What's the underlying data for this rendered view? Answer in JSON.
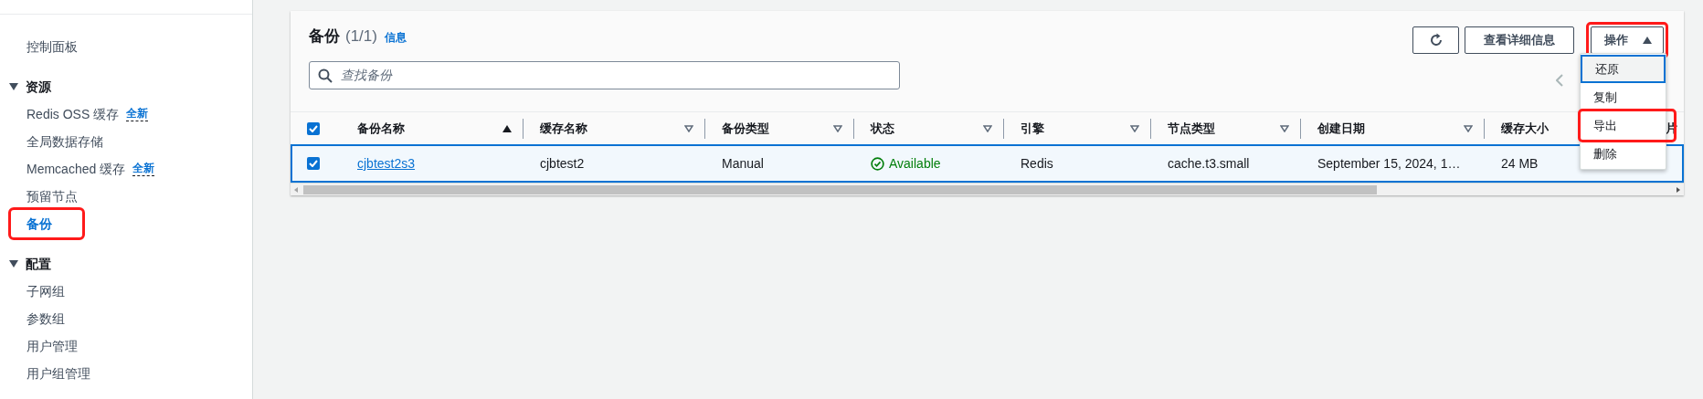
{
  "sidebar": [
    {
      "kind": "link",
      "label": "控制面板",
      "selected": false,
      "highlighted": false
    },
    {
      "kind": "section",
      "label": "资源",
      "expanded": true,
      "children": [
        {
          "label": "Redis OSS 缓存",
          "badge": "全新",
          "selected": false,
          "highlighted": false
        },
        {
          "label": "全局数据存储",
          "selected": false,
          "highlighted": false
        },
        {
          "label": "Memcached 缓存",
          "badge": "全新",
          "selected": false,
          "highlighted": false
        },
        {
          "label": "预留节点",
          "selected": false,
          "highlighted": false
        },
        {
          "label": "备份",
          "selected": true,
          "highlighted": true
        }
      ]
    },
    {
      "kind": "section",
      "label": "配置",
      "expanded": true,
      "children": [
        {
          "label": "子网组",
          "selected": false,
          "highlighted": false
        },
        {
          "label": "参数组",
          "selected": false,
          "highlighted": false
        },
        {
          "label": "用户管理",
          "selected": false,
          "highlighted": false
        },
        {
          "label": "用户组管理",
          "selected": false,
          "highlighted": false
        }
      ]
    }
  ],
  "panel": {
    "title": "备份",
    "count": "(1/1)",
    "info_link": "信息",
    "search": {
      "placeholder": "查找备份"
    },
    "buttons": [
      {
        "kind": "refresh"
      },
      {
        "kind": "text",
        "label": "查看详细信息"
      },
      {
        "kind": "dropdown",
        "label": "操作",
        "expanded": true,
        "highlighted": true
      }
    ],
    "menu": [
      {
        "label": "还原",
        "focused": true,
        "highlighted": false
      },
      {
        "label": "复制",
        "focused": false,
        "highlighted": false
      },
      {
        "label": "导出",
        "focused": false,
        "highlighted": true
      },
      {
        "label": "删除",
        "focused": false,
        "highlighted": false
      }
    ],
    "select_all": {
      "checked": true
    },
    "columns": [
      {
        "label": "备份名称",
        "sorted": true
      },
      {
        "label": "缓存名称",
        "sorted": false
      },
      {
        "label": "备份类型",
        "sorted": false
      },
      {
        "label": "状态",
        "sorted": false
      },
      {
        "label": "引擎",
        "sorted": false
      },
      {
        "label": "节点类型",
        "sorted": false
      },
      {
        "label": "创建日期",
        "sorted": false
      },
      {
        "label": "缓存大小"
      },
      {
        "label": "片"
      }
    ],
    "rows": [
      {
        "selected": true,
        "cells": [
          {
            "kind": "link",
            "text": "cjbtest2s3"
          },
          {
            "kind": "text",
            "text": "cjbtest2"
          },
          {
            "kind": "text",
            "text": "Manual"
          },
          {
            "kind": "status",
            "text": "Available"
          },
          {
            "kind": "text",
            "text": "Redis"
          },
          {
            "kind": "text",
            "text": "cache.t3.small"
          },
          {
            "kind": "text",
            "text": "September 15, 2024, 1…"
          },
          {
            "kind": "text",
            "text": "24 MB"
          }
        ]
      }
    ]
  }
}
